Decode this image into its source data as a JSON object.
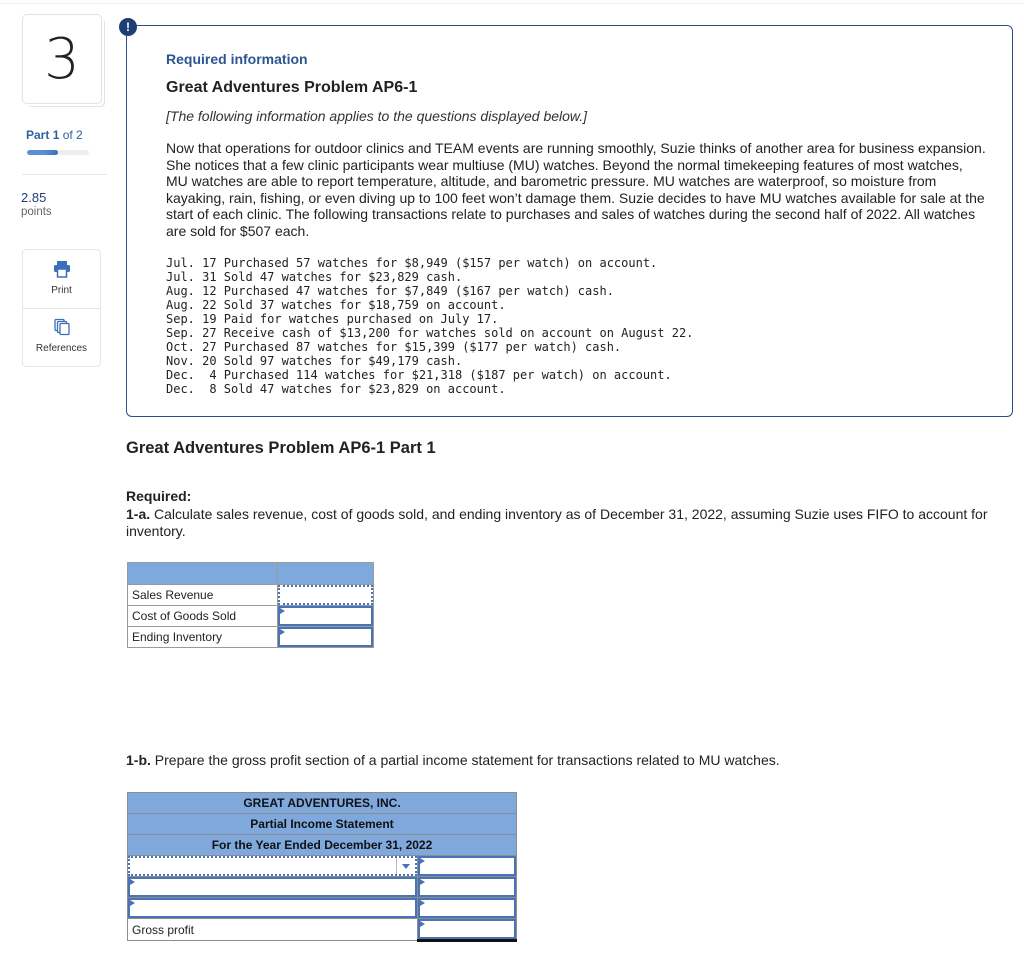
{
  "sidebar": {
    "question_number": "3",
    "part_prefix": "Part",
    "part_current": "1",
    "part_suffix": "of 2",
    "progress_fraction": 0.5,
    "points_value": "2.85",
    "points_label": "points",
    "tools": [
      {
        "label": "Print",
        "icon": "printer-icon"
      },
      {
        "label": "References",
        "icon": "references-icon"
      }
    ]
  },
  "info": {
    "badge": "!",
    "required_info": "Required information",
    "problem_title": "Great Adventures Problem AP6-1",
    "applies_note": "[The following information applies to the questions displayed below.]",
    "body": "Now that operations for outdoor clinics and TEAM events are running smoothly, Suzie thinks of another area for business expansion. She notices that a few clinic participants wear multiuse (MU) watches. Beyond the normal timekeeping features of most watches, MU watches are able to report temperature, altitude, and barometric pressure. MU watches are waterproof, so moisture from kayaking, rain, fishing, or even diving up to 100 feet won’t damage them. Suzie decides to have MU watches available for sale at the start of each clinic. The following transactions relate to purchases and sales of watches during the second half of 2022. All watches are sold for $507 each.",
    "transactions": [
      "Jul. 17 Purchased 57 watches for $8,949 ($157 per watch) on account.",
      "Jul. 31 Sold 47 watches for $23,829 cash.",
      "Aug. 12 Purchased 47 watches for $7,849 ($167 per watch) cash.",
      "Aug. 22 Sold 37 watches for $18,759 on account.",
      "Sep. 19 Paid for watches purchased on July 17.",
      "Sep. 27 Receive cash of $13,200 for watches sold on account on August 22.",
      "Oct. 27 Purchased 87 watches for $15,399 ($177 per watch) cash.",
      "Nov. 20 Sold 97 watches for $49,179 cash.",
      "Dec.  4 Purchased 114 watches for $21,318 ($187 per watch) on account.",
      "Dec.  8 Sold 47 watches for $23,829 on account."
    ]
  },
  "part1": {
    "title": "Great Adventures Problem AP6-1 Part 1",
    "required_label": "Required:",
    "q1a_tag": "1-a.",
    "q1a_text": " Calculate sales revenue, cost of goods sold, and ending inventory as of December 31, 2022, assuming Suzie uses FIFO to account for inventory.",
    "table1a": {
      "rows": [
        {
          "label": "Sales Revenue",
          "value": ""
        },
        {
          "label": "Cost of Goods Sold",
          "value": ""
        },
        {
          "label": "Ending Inventory",
          "value": ""
        }
      ]
    },
    "q1b_tag": "1-b.",
    "q1b_text": " Prepare the gross profit section of a partial income statement for transactions related to MU watches.",
    "table1b": {
      "headers": [
        "GREAT ADVENTURES, INC.",
        "Partial Income Statement",
        "For the Year Ended December 31, 2022"
      ],
      "dropdown_value": "",
      "rows": [
        {
          "label": "",
          "value": ""
        },
        {
          "label": "",
          "value": ""
        },
        {
          "label": "",
          "value": ""
        },
        {
          "label": "Gross profit",
          "value": ""
        }
      ]
    }
  }
}
